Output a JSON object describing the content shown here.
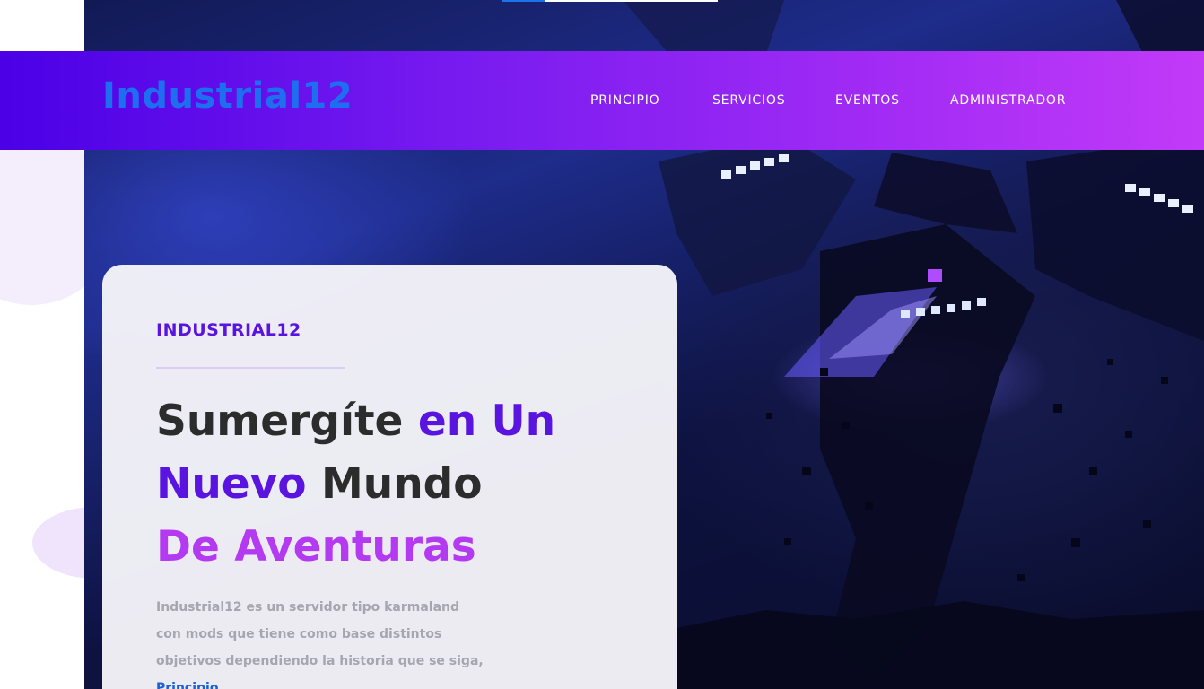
{
  "navbar": {
    "brand": "Industrial12",
    "items": [
      {
        "label": "PRINCIPIO"
      },
      {
        "label": "SERVICIOS"
      },
      {
        "label": "EVENTOS"
      },
      {
        "label": "ADMINISTRADOR"
      }
    ]
  },
  "hero": {
    "eyebrow": "INDUSTRIAL12",
    "headline": {
      "part1": "Sumergíte ",
      "part2": "en Un",
      "part3": "Nuevo",
      "part4": " Mundo",
      "part5": " De Aventuras"
    },
    "description": {
      "text": "Industrial12 es un servidor tipo karmaland con mods que tiene como base distintos objetivos dependiendo la historia que se siga, ",
      "link_label": "Principio",
      "trailing": "."
    }
  },
  "colors": {
    "navbar_gradient_start": "#4b00e6",
    "navbar_gradient_end": "#c23af8",
    "brand": "#1e6ff0",
    "accent_purple": "#5a14e0",
    "accent_violet": "#b43af2",
    "link_blue": "#1a5fd6"
  }
}
